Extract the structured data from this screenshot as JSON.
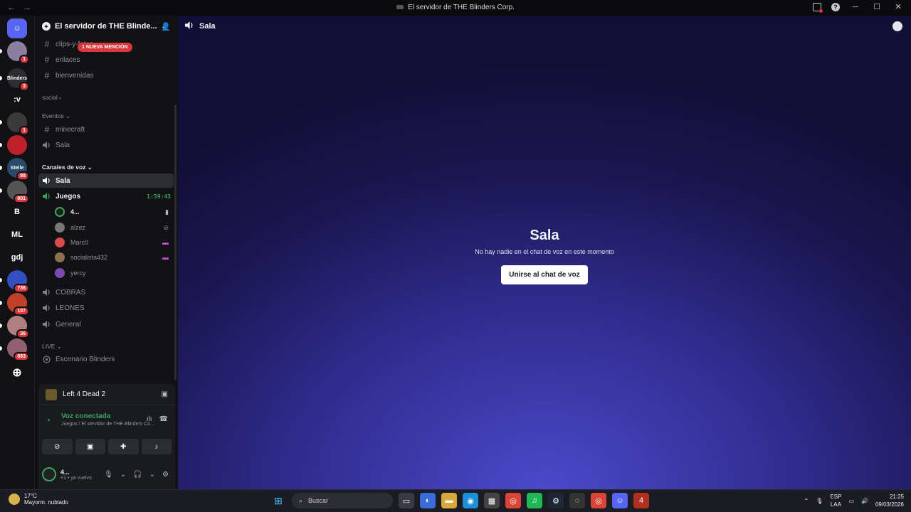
{
  "window": {
    "title": "El servidor de THE Blinders Corp."
  },
  "servers": [
    {
      "label": "",
      "badge": "",
      "color": "#5865f2",
      "icon": "discord-home-icon"
    },
    {
      "label": "",
      "badge": "1",
      "color": "#8a7fa0"
    },
    {
      "label": "Blinders",
      "badge": "3",
      "color": "#2b2d31"
    },
    {
      "label": ":v",
      "badge": "",
      "color": "#121214"
    },
    {
      "label": "",
      "badge": "1",
      "color": "#3a3a3a"
    },
    {
      "label": "",
      "badge": "",
      "color": "#c0202a"
    },
    {
      "label": "Stelle",
      "badge": "88",
      "color": "#2a4a6a"
    },
    {
      "label": "",
      "badge": "801",
      "color": "#555"
    },
    {
      "label": "B",
      "badge": "",
      "color": "#121214"
    },
    {
      "label": "ML",
      "badge": "",
      "color": "#121214"
    },
    {
      "label": "gdj",
      "badge": "",
      "color": "#121214"
    },
    {
      "label": "",
      "badge": "736",
      "color": "#3350c0"
    },
    {
      "label": "",
      "badge": "107",
      "color": "#c0402a"
    },
    {
      "label": "",
      "badge": "36",
      "color": "#b08080"
    },
    {
      "label": "",
      "badge": "883",
      "color": "#906070"
    }
  ],
  "sidebar": {
    "server_name": "El servidor de THE Blinde...",
    "mention_badge": "1 NUEVA MENCIÓN",
    "channels_top": [
      "clips-y-fotos",
      "enlaces",
      "bienvenidas"
    ],
    "cat_social": "social",
    "cat_eventos": "Eventos",
    "eventos": [
      {
        "name": "minecraft",
        "type": "text"
      },
      {
        "name": "Sala",
        "type": "voice"
      }
    ],
    "cat_voz": "Canales de voz",
    "voz_sala": "Sala",
    "voz_juegos": "Juegos",
    "juegos_timer": "1:59:43",
    "members": [
      {
        "name": "4...",
        "color": "#1f1f1f",
        "status": "game-icon"
      },
      {
        "name": "alzez",
        "color": "#777",
        "status": "deafened-icon"
      },
      {
        "name": "Marc0",
        "color": "#d94a4a",
        "status": "streaming-icon"
      },
      {
        "name": "socialista432",
        "color": "#8a7050",
        "status": "streaming-icon"
      },
      {
        "name": "yercy",
        "color": "#7a4ab0",
        "status": ""
      }
    ],
    "voz_more": [
      "COBRAS",
      "LEONES",
      "General"
    ],
    "cat_live": "LIVE",
    "stage": "Escenario Blinders"
  },
  "panel": {
    "game": "Left 4 Dead 2",
    "voice_title": "Voz conectada",
    "voice_sub": "Juegos / El servidor de THE Blinders Co...",
    "user_name": "4...",
    "user_status": "+1 • ya vuelvo"
  },
  "main": {
    "channel": "Sala",
    "empty_title": "Sala",
    "empty_sub": "No hay nadie en el chat de voz en este momento",
    "join_label": "Unirse al chat de voz"
  },
  "taskbar": {
    "temp": "17°C",
    "weather": "Mayorm. nublado",
    "search_placeholder": "Buscar",
    "lang1": "ESP",
    "lang2": "LAA",
    "time": "21:25",
    "date": "09/03/2026"
  }
}
